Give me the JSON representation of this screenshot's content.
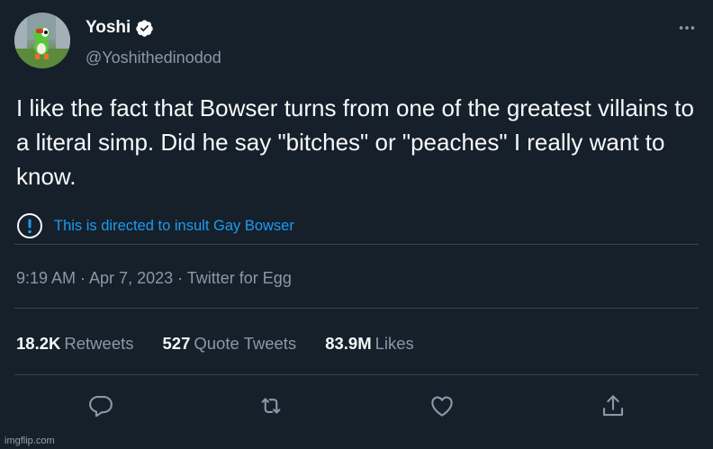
{
  "header": {
    "display_name": "Yoshi",
    "handle": "@Yoshithedinodod",
    "verified_icon": "verified-badge-icon",
    "more_icon": "more-dots-icon"
  },
  "tweet": {
    "text": "I like the fact that Bowser turns from one of the greatest villains to a literal simp. Did he say \"bitches\" or \"peaches\" I really want to know.",
    "notice_icon": "exclamation-circle-icon",
    "notice_text": "This is directed to insult Gay Bowser",
    "meta": "9:19 AM · Apr 7, 2023 · Twitter for Egg"
  },
  "stats": {
    "retweets_count": "18.2K",
    "retweets_label": "Retweets",
    "quotes_count": "527",
    "quotes_label": "Quote Tweets",
    "likes_count": "83.9M",
    "likes_label": "Likes"
  },
  "actions": [
    "reply-icon",
    "retweet-icon",
    "like-icon",
    "share-icon"
  ],
  "watermark": "imgflip.com",
  "colors": {
    "background": "#15202b",
    "accent": "#1d9bf0",
    "secondary_text": "#8b98a5",
    "divider": "#38444d"
  }
}
